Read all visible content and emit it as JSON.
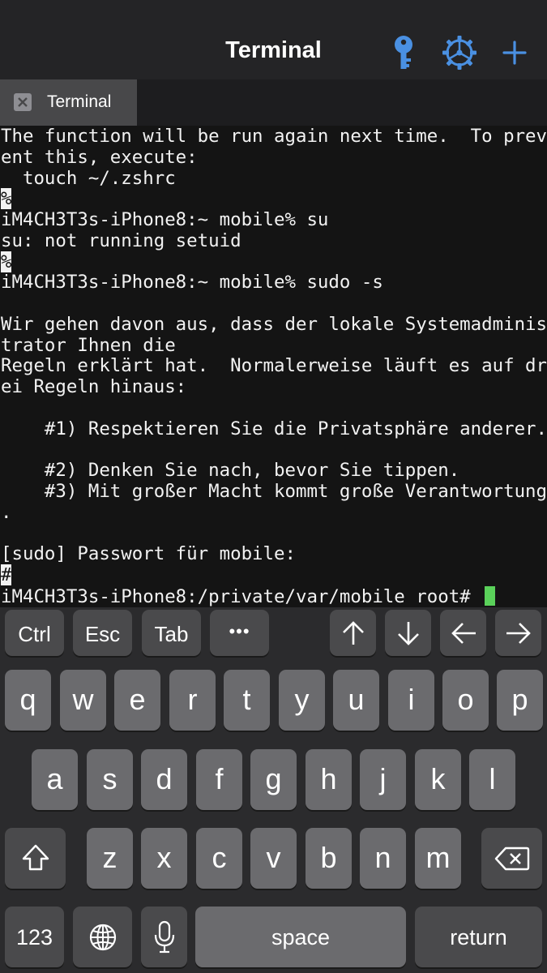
{
  "nav": {
    "title": "Terminal",
    "icons": [
      "key-icon",
      "gear-icon",
      "plus-icon"
    ],
    "accent_color": "#4a90e2"
  },
  "tabs": [
    {
      "label": "Terminal",
      "close_icon": "close-icon"
    }
  ],
  "terminal": {
    "lines": [
      "The function will be run again next time.  To prev",
      "ent this, execute:",
      "  touch ~/.zshrc",
      "%",
      "iM4CH3T3s-iPhone8:~ mobile% su",
      "su: not running setuid",
      "%",
      "iM4CH3T3s-iPhone8:~ mobile% sudo -s",
      "",
      "Wir gehen davon aus, dass der lokale Systemadminis",
      "trator Ihnen die",
      "Regeln erklärt hat.  Normalerweise läuft es auf dr",
      "ei Regeln hinaus:",
      "",
      "    #1) Respektieren Sie die Privatsphäre anderer.",
      "",
      "    #2) Denken Sie nach, bevor Sie tippen.",
      "    #3) Mit großer Macht kommt große Verantwortung",
      ".",
      "",
      "[sudo] Passwort für mobile:",
      "#",
      "iM4CH3T3s-iPhone8:/private/var/mobile root# "
    ],
    "cursor_color": "#5ad15a"
  },
  "keyboard": {
    "toolbar": {
      "ctrl": "Ctrl",
      "esc": "Esc",
      "tab": "Tab",
      "more": "•••",
      "arrows": [
        "arrow-up-icon",
        "arrow-down-icon",
        "arrow-left-icon",
        "arrow-right-icon"
      ]
    },
    "row1": [
      "q",
      "w",
      "e",
      "r",
      "t",
      "y",
      "u",
      "i",
      "o",
      "p"
    ],
    "row2": [
      "a",
      "s",
      "d",
      "f",
      "g",
      "h",
      "j",
      "k",
      "l"
    ],
    "row3": [
      "z",
      "x",
      "c",
      "v",
      "b",
      "n",
      "m"
    ],
    "bottom": {
      "numbers": "123",
      "space": "space",
      "return": "return"
    }
  }
}
